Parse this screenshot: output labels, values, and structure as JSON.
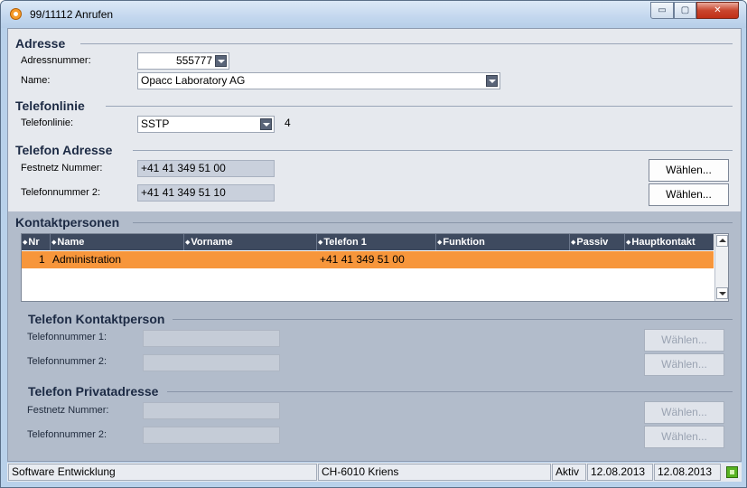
{
  "window": {
    "title": "99/11112 Anrufen",
    "controls": {
      "minimize": "▭",
      "maximize": "▢",
      "close": "✕"
    }
  },
  "adresse": {
    "heading": "Adresse",
    "adressnummer_label": "Adressnummer:",
    "adressnummer_value": "555777",
    "name_label": "Name:",
    "name_value": "Opacc Laboratory AG"
  },
  "telefonlinie": {
    "heading": "Telefonlinie",
    "label": "Telefonlinie:",
    "value": "SSTP",
    "count": "4"
  },
  "telefon_adresse": {
    "heading": "Telefon Adresse",
    "festnetz_label": "Festnetz Nummer:",
    "festnetz_value": "+41 41 349 51 00",
    "telefon2_label": "Telefonnummer 2:",
    "telefon2_value": "+41 41 349 51 10",
    "choose1": "Wählen...",
    "choose2": "Wählen..."
  },
  "kontaktpersonen": {
    "heading": "Kontaktpersonen",
    "columns": [
      "Nr",
      "Name",
      "Vorname",
      "Telefon 1",
      "Funktion",
      "Passiv",
      "Hauptkontakt"
    ],
    "rows": [
      {
        "nr": "1",
        "name": "Administration",
        "vorname": "",
        "telefon1": "+41 41 349 51 00",
        "funktion": "",
        "passiv": "",
        "hauptkontakt": ""
      }
    ]
  },
  "telefon_kontaktperson": {
    "heading": "Telefon Kontaktperson",
    "telefon1_label": "Telefonnummer 1:",
    "telefon2_label": "Telefonnummer 2:",
    "choose1": "Wählen...",
    "choose2": "Wählen..."
  },
  "telefon_privatadresse": {
    "heading": "Telefon Privatadresse",
    "festnetz_label": "Festnetz Nummer:",
    "telefon2_label": "Telefonnummer 2:",
    "choose1": "Wählen...",
    "choose2": "Wählen..."
  },
  "statusbar": {
    "department": "Software Entwicklung",
    "location": "CH-6010 Kriens",
    "status": "Aktiv",
    "date1": "12.08.2013",
    "date2": "12.08.2013"
  },
  "colors": {
    "selected_row": "#f7963b",
    "grid_header": "#3e4a5f",
    "status_indicator": "#58b323"
  },
  "icons": {
    "app": "app-target-icon",
    "dropdown": "chevron-down-icon",
    "sort": "sort-updown-icon",
    "status": "status-green-icon"
  }
}
